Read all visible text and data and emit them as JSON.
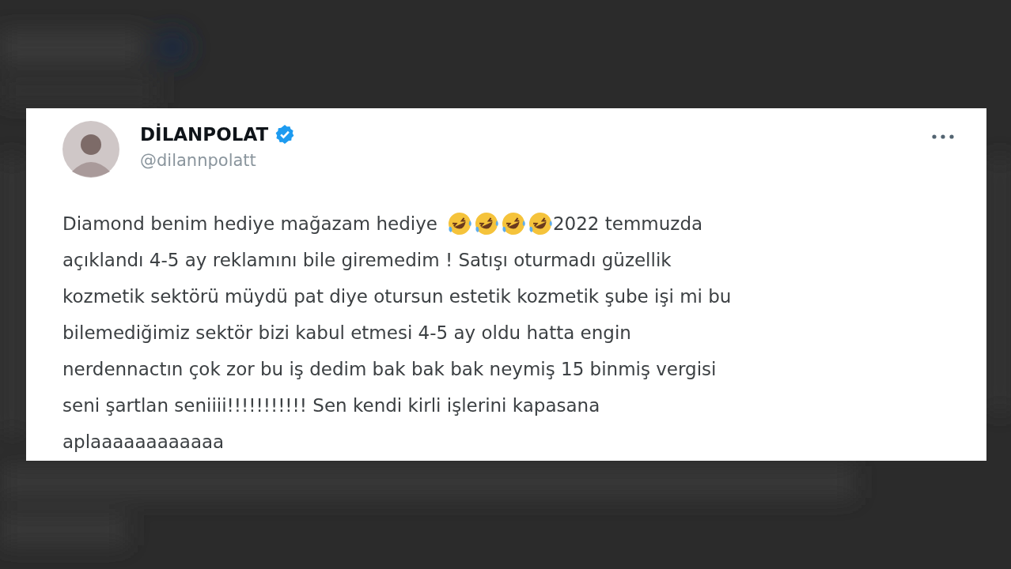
{
  "tweet": {
    "display_name": "DİLANPOLAT",
    "verified": true,
    "handle": "@dilannpolatt",
    "lines": [
      [
        {
          "kind": "text",
          "text": "Diamond benim hediye mağazam hediye"
        },
        {
          "kind": "emoji"
        },
        {
          "kind": "emoji"
        },
        {
          "kind": "emoji"
        },
        {
          "kind": "emoji"
        },
        {
          "kind": "text",
          "text": "2022 temmuzda"
        }
      ],
      [
        {
          "kind": "text",
          "text": "açıklandı 4-5 ay reklamını bile giremedim ! Satışı oturmadı güzellik"
        }
      ],
      [
        {
          "kind": "text",
          "text": "kozmetik sektörü müydü pat diye otursun estetik kozmetik şube işi mi bu"
        }
      ],
      [
        {
          "kind": "text",
          "text": "bilemediğimiz sektör bizi kabul etmesi 4-5 ay oldu hatta engin"
        }
      ],
      [
        {
          "kind": "text",
          "text": "nerdennactın çok zor bu iş dedim bak bak bak neymiş 15 binmiş vergisi"
        }
      ],
      [
        {
          "kind": "text",
          "text": "seni şartlan seniiii!!!!!!!!!!! Sen kendi kirli işlerini kapasana"
        }
      ],
      [
        {
          "kind": "text",
          "text": "aplaaaaaaaaaaaa"
        }
      ]
    ]
  }
}
